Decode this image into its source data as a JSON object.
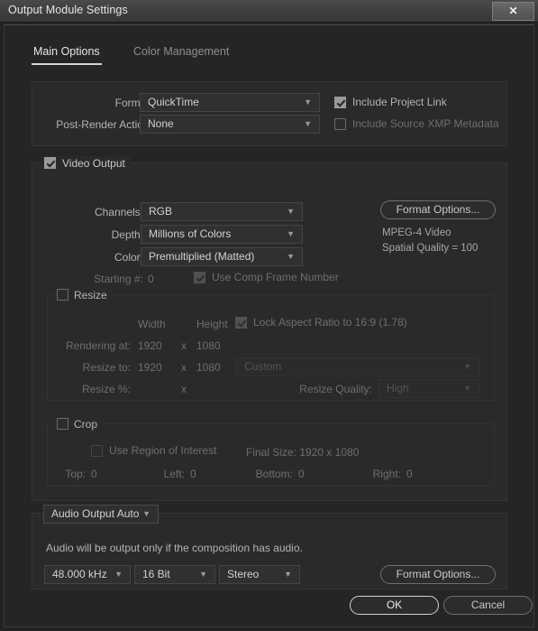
{
  "window": {
    "title": "Output Module Settings",
    "close_label": "✕"
  },
  "tabs": [
    {
      "label": "Main Options",
      "active": true
    },
    {
      "label": "Color Management",
      "active": false
    }
  ],
  "format_section": {
    "format_label": "Format:",
    "format_value": "QuickTime",
    "post_render_label": "Post-Render Action:",
    "post_render_value": "None",
    "include_project_link_label": "Include Project Link",
    "include_project_link_checked": true,
    "include_xmp_label": "Include Source XMP Metadata",
    "include_xmp_checked": false
  },
  "video_output": {
    "group_label": "Video Output",
    "group_checked": true,
    "channels_label": "Channels:",
    "channels_value": "RGB",
    "depth_label": "Depth:",
    "depth_value": "Millions of Colors",
    "color_label": "Color:",
    "color_value": "Premultiplied (Matted)",
    "starting_label": "Starting #:",
    "starting_value": "0",
    "use_comp_frame_label": "Use Comp Frame Number",
    "use_comp_frame_checked": true,
    "format_options_label": "Format Options...",
    "codec_info_line1": "MPEG-4 Video",
    "codec_info_line2": "Spatial Quality = 100"
  },
  "resize": {
    "group_label": "Resize",
    "group_checked": false,
    "width_header": "Width",
    "height_header": "Height",
    "lock_aspect_label": "Lock Aspect Ratio to 16:9 (1.78)",
    "lock_aspect_checked": true,
    "rendering_at_label": "Rendering at:",
    "rendering_width": "1920",
    "rendering_x": "x",
    "rendering_height": "1080",
    "resize_to_label": "Resize to:",
    "resize_width": "1920",
    "resize_x": "x",
    "resize_height": "1080",
    "preset_value": "Custom",
    "resize_pct_label": "Resize %:",
    "resize_pct_x": "x",
    "resize_quality_label": "Resize Quality:",
    "resize_quality_value": "High"
  },
  "crop": {
    "group_label": "Crop",
    "group_checked": false,
    "use_roi_label": "Use Region of Interest",
    "use_roi_checked": false,
    "final_size_label": "Final Size: 1920 x 1080",
    "top_label": "Top:",
    "top_value": "0",
    "left_label": "Left:",
    "left_value": "0",
    "bottom_label": "Bottom:",
    "bottom_value": "0",
    "right_label": "Right:",
    "right_value": "0"
  },
  "audio": {
    "output_mode": "Audio Output Auto",
    "note": "Audio will be output only if the composition has audio.",
    "sample_rate": "48.000 kHz",
    "bit_depth": "16 Bit",
    "channels": "Stereo",
    "format_options_label": "Format Options..."
  },
  "footer": {
    "ok_label": "OK",
    "cancel_label": "Cancel"
  },
  "colors": {
    "window_bg": "#232323",
    "panel_bg": "#2a2a2a",
    "accent_border": "#d2d2d2",
    "text": "#c8c8c8",
    "disabled_text": "#6e6e6e"
  }
}
